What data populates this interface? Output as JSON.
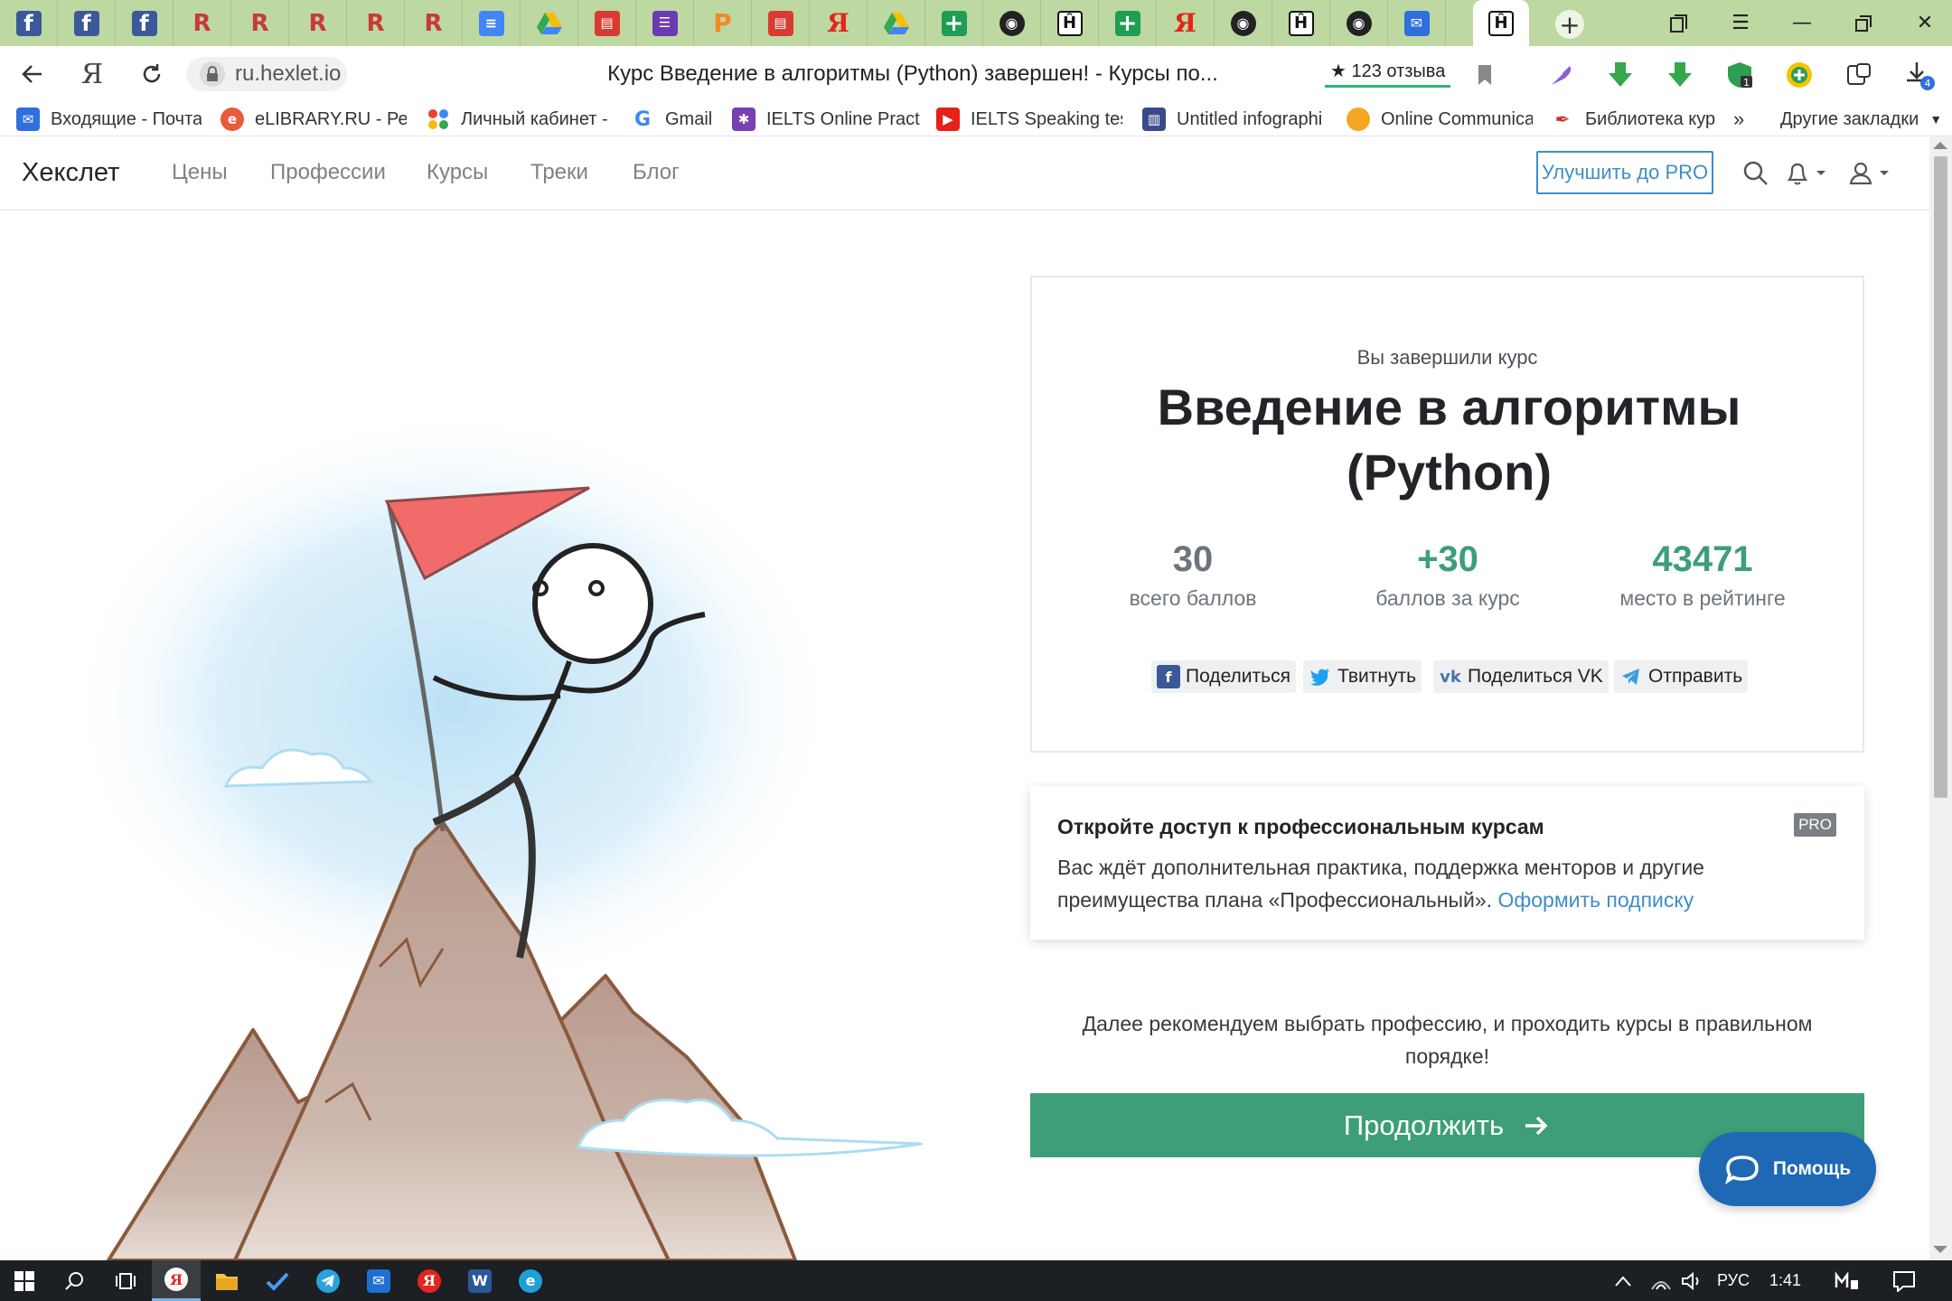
{
  "colors": {
    "tabstrip_bg": "#bdd8a1",
    "accent_green": "#3d9e78",
    "stat_gray": "#6c757d",
    "link_blue": "#3e8ec8",
    "help_blue": "#1f69b4",
    "taskbar_bg": "#1c1f24"
  },
  "browser": {
    "tabs": [
      {
        "icon": "facebook-icon",
        "glyph": "f"
      },
      {
        "icon": "facebook-icon",
        "glyph": "f"
      },
      {
        "icon": "facebook-icon",
        "glyph": "f"
      },
      {
        "icon": "rk-icon",
        "glyph": "R"
      },
      {
        "icon": "rk-icon",
        "glyph": "R"
      },
      {
        "icon": "rk-icon",
        "glyph": "R"
      },
      {
        "icon": "rk-icon",
        "glyph": "R"
      },
      {
        "icon": "rk-icon",
        "glyph": "R"
      },
      {
        "icon": "google-docs-icon",
        "glyph": "≡"
      },
      {
        "icon": "google-drive-icon",
        "glyph": ""
      },
      {
        "icon": "clapperboard-icon",
        "glyph": "▤"
      },
      {
        "icon": "list-icon",
        "glyph": "☰"
      },
      {
        "icon": "p-icon",
        "glyph": "P"
      },
      {
        "icon": "clapperboard-icon",
        "glyph": "▤"
      },
      {
        "icon": "yandex-icon",
        "glyph": "Я"
      },
      {
        "icon": "google-drive-icon",
        "glyph": ""
      },
      {
        "icon": "google-sheets-icon",
        "glyph": "+"
      },
      {
        "icon": "github-icon",
        "glyph": "◉"
      },
      {
        "icon": "hexlet-icon",
        "glyph": "Ĥ"
      },
      {
        "icon": "google-sheets-icon",
        "glyph": "+"
      },
      {
        "icon": "yandex-icon",
        "glyph": "Я"
      },
      {
        "icon": "github-icon",
        "glyph": "◉"
      },
      {
        "icon": "hexlet-icon",
        "glyph": "Ĥ"
      },
      {
        "icon": "github-icon",
        "glyph": "◉"
      },
      {
        "icon": "mail-icon",
        "glyph": "✉"
      },
      {
        "icon": "hexlet-icon",
        "glyph": "Ĥ",
        "active": true
      }
    ],
    "url": "ru.hexlet.io",
    "page_title": "Курс Введение в алгоритмы (Python) завершен! - Курсы по...",
    "reviews": "★ 123 отзыва",
    "bookmarks": [
      {
        "label": "Входящие - Почта",
        "icon": "mail-icon"
      },
      {
        "label": "eLIBRARY.RU - Реа",
        "icon": "elibrary-icon"
      },
      {
        "label": "Личный кабинет -",
        "icon": "dots-icon"
      },
      {
        "label": "Gmail",
        "icon": "google-icon"
      },
      {
        "label": "IELTS Online Practic",
        "icon": "ielts-icon"
      },
      {
        "label": "IELTS Speaking test",
        "icon": "youtube-icon"
      },
      {
        "label": "Untitled infographi",
        "icon": "infographic-icon"
      },
      {
        "label": "Online Communica",
        "icon": "circle-icon"
      },
      {
        "label": "Библиотека кур",
        "icon": "quill-icon"
      }
    ],
    "bookmarks_more": "»",
    "other_bookmarks": "Другие закладки",
    "downloads_badge": "4"
  },
  "site": {
    "brand": "Хекслет",
    "menu": [
      "Цены",
      "Профессии",
      "Курсы",
      "Треки",
      "Блог"
    ],
    "pro_button": "Улучшить до PRO"
  },
  "completion": {
    "label": "Вы завершили курс",
    "course_title": "Введение в алгоритмы (Python)",
    "stats": [
      {
        "value": "30",
        "label": "всего баллов",
        "color": "#6c757d"
      },
      {
        "value": "+30",
        "label": "баллов за курс",
        "color": "#3d9e78"
      },
      {
        "value": "43471",
        "label": "место в рейтинге",
        "color": "#3d9e78"
      }
    ],
    "share": [
      {
        "label": "Поделиться",
        "icon": "facebook-icon"
      },
      {
        "label": "Твитнуть",
        "icon": "twitter-icon"
      },
      {
        "label": "Поделиться VK",
        "icon": "vk-icon"
      },
      {
        "label": "Отправить",
        "icon": "telegram-icon"
      }
    ]
  },
  "promo": {
    "title": "Откройте доступ к профессиональным курсам",
    "badge": "PRO",
    "text": "Вас ждёт дополнительная практика, поддержка менторов и другие преимущества плана «Профессиональный».",
    "link": "Оформить подписку"
  },
  "recommend": "Далее рекомендуем выбрать профессию, и проходить курсы в правильном порядке!",
  "continue_button": "Продолжить",
  "help_button": "Помощь",
  "taskbar": {
    "apps": [
      "windows-start-icon",
      "search-icon",
      "task-view-icon",
      "yandex-browser-icon",
      "file-explorer-icon",
      "todo-icon",
      "telegram-icon",
      "mail-icon",
      "yandex-icon",
      "word-icon",
      "edge-icon"
    ],
    "lang": "РУС",
    "time": "1:41"
  }
}
